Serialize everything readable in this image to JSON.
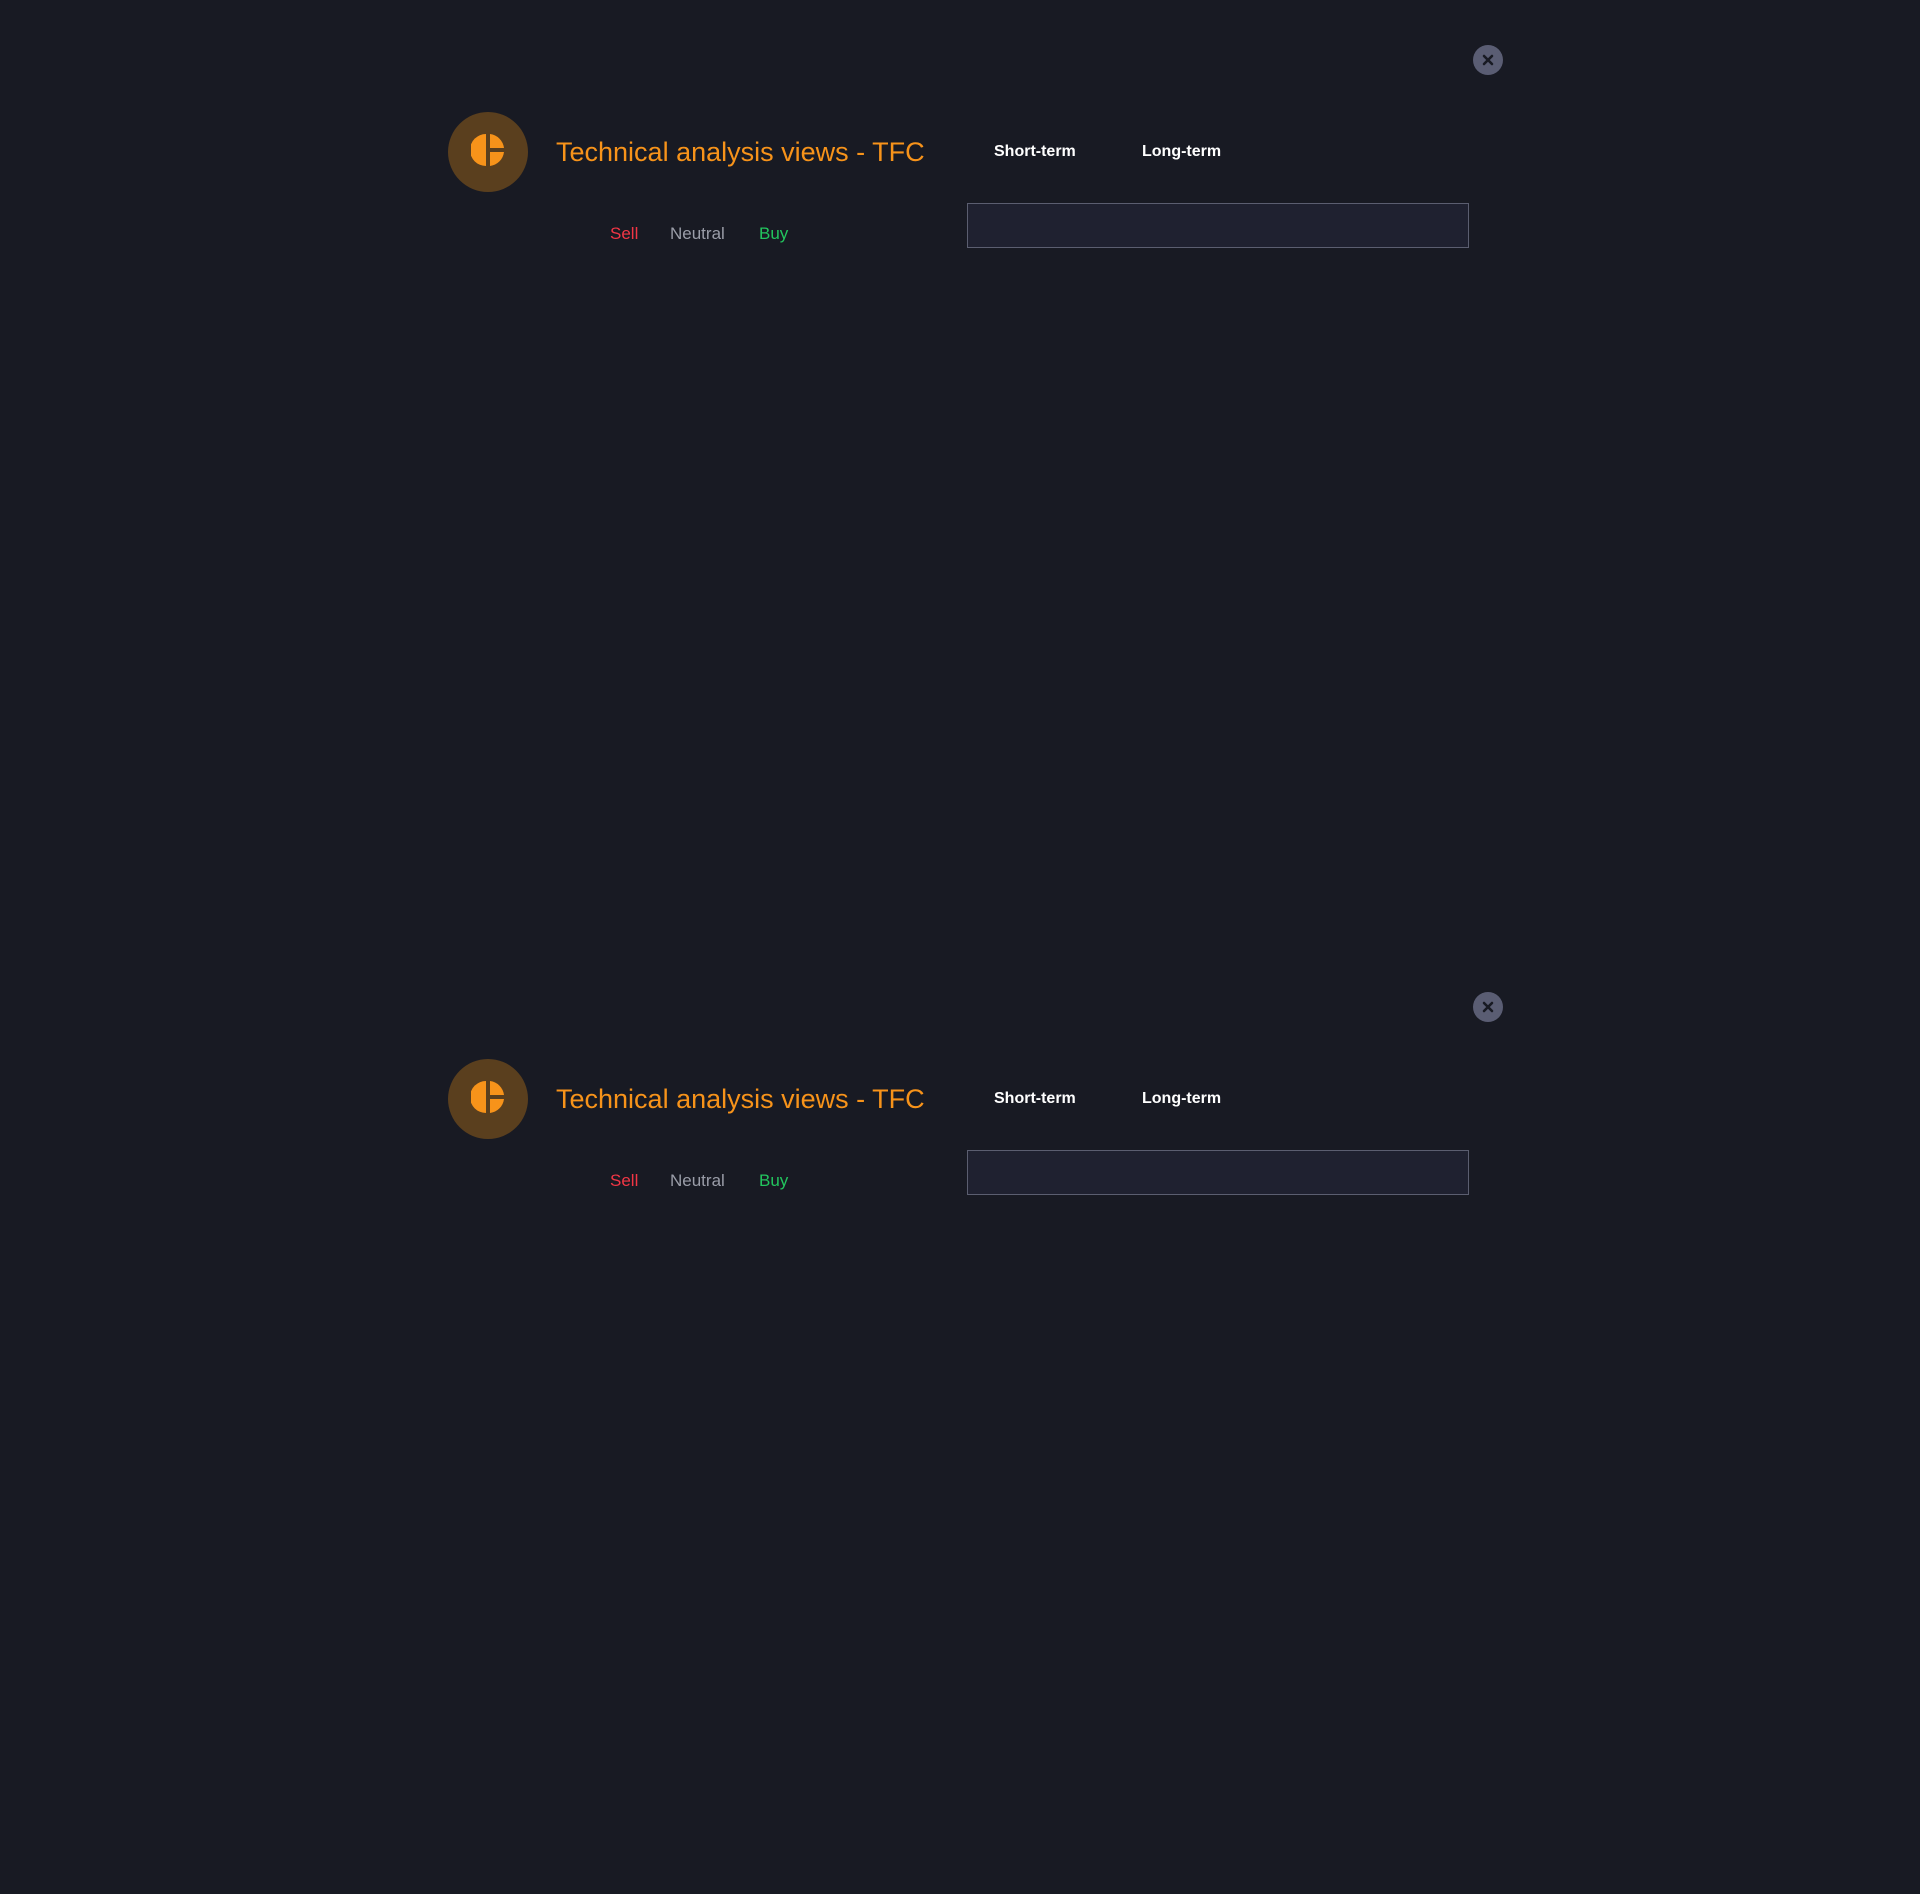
{
  "panels": [
    {
      "title": "Technical analysis views - TFC",
      "tabs": [
        {
          "label": "Short-term"
        },
        {
          "label": "Long-term"
        }
      ],
      "legend": {
        "sell": "Sell",
        "neutral": "Neutral",
        "buy": "Buy"
      },
      "icons": {
        "logo": "pie-chart-icon",
        "close": "close-icon"
      }
    },
    {
      "title": "Technical analysis views - TFC",
      "tabs": [
        {
          "label": "Short-term"
        },
        {
          "label": "Long-term"
        }
      ],
      "legend": {
        "sell": "Sell",
        "neutral": "Neutral",
        "buy": "Buy"
      },
      "icons": {
        "logo": "pie-chart-icon",
        "close": "close-icon"
      }
    }
  ],
  "colors": {
    "background": "#181a23",
    "accent": "#f7931a",
    "logo_bg": "#5a3f1e",
    "sell": "#f23645",
    "neutral": "#9a9da8",
    "buy": "#22c55e",
    "close_bg": "#5a5d73",
    "field_bg": "#1f2130",
    "field_border": "#5b5e70"
  }
}
